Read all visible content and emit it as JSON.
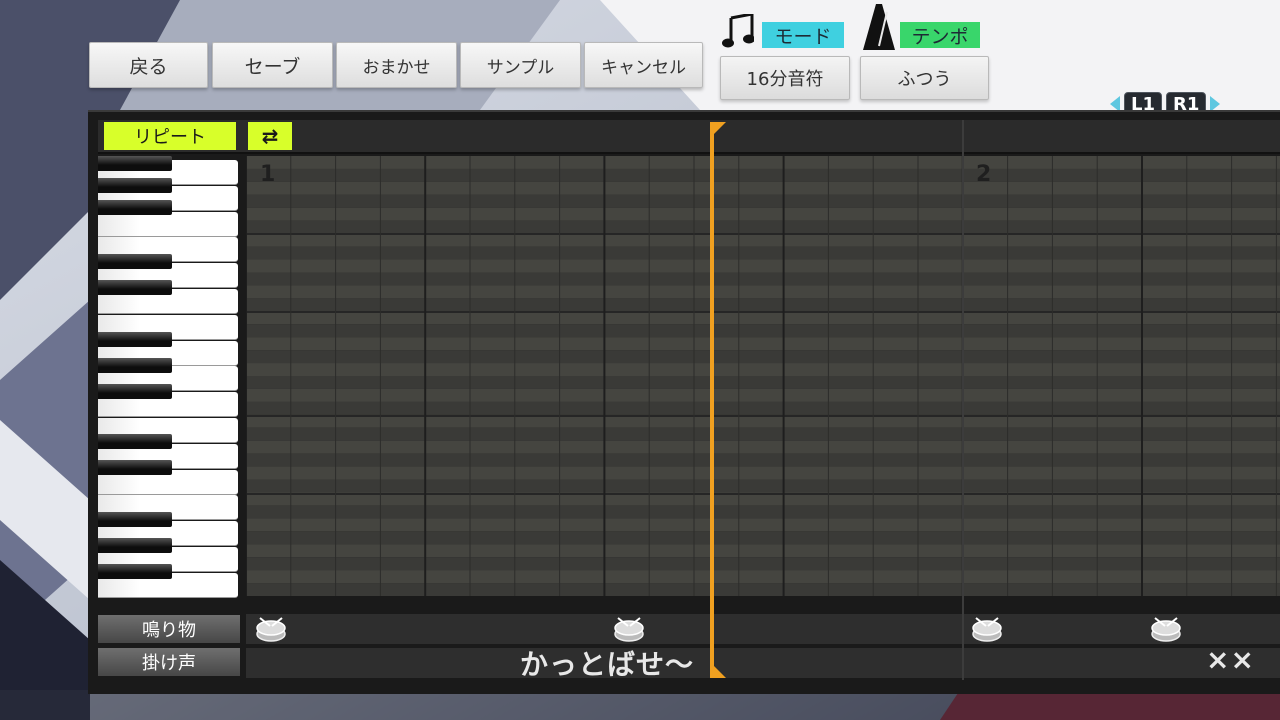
{
  "toolbar": {
    "back_label": "戻る",
    "save_label": "セーブ",
    "auto_label": "おまかせ",
    "sample_label": "サンプル",
    "cancel_label": "キャンセル"
  },
  "settings": {
    "mode_label": "モード",
    "mode_value": "16分音符",
    "tempo_label": "テンポ",
    "tempo_value": "ふつう",
    "mode_color": "#3fd0e0",
    "tempo_color": "#39d66b"
  },
  "shoulder": {
    "left": "L1",
    "right": "R1"
  },
  "editor": {
    "repeat_label": "リピート",
    "loop_icon": "loop-icon",
    "measures": [
      "1",
      "2"
    ]
  },
  "tracks": {
    "percussion_label": "鳴り物",
    "voice_label": "掛け声",
    "voice_texts": [
      "かっとばせ〜",
      "××"
    ]
  },
  "colors": {
    "accent": "#d8ff2a",
    "playhead": "#f0a020"
  }
}
